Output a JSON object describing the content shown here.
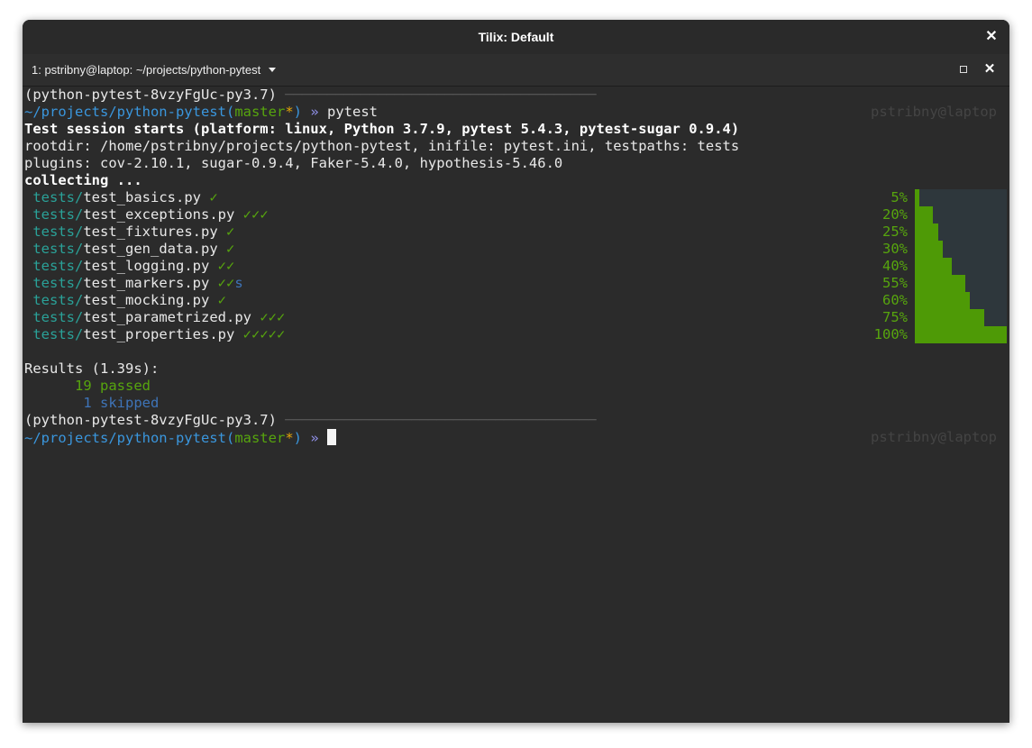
{
  "window": {
    "title": "Tilix: Default",
    "session_tab": "1: pstribny@laptop: ~/projects/python-pytest"
  },
  "terminal": {
    "venv": "(python-pytest-8vzyFgUc-py3.7)",
    "rule": " ─────────────────────────────────────",
    "cwd": "~/projects/python-pytest",
    "paren_open": "(",
    "branch": "master",
    "dirty": "*",
    "paren_close": ")",
    "arrow": " »",
    "command": " pytest",
    "right_prompt": "pstribny@laptop",
    "session_line": "Test session starts (platform: linux, Python 3.7.9, pytest 5.4.3, pytest-sugar 0.9.4)",
    "rootdir_line": "rootdir: /home/pstribny/projects/python-pytest, inifile: pytest.ini, testpaths: tests",
    "plugins_line": "plugins: cov-2.10.1, sugar-0.9.4, Faker-5.4.0, hypothesis-5.46.0",
    "collecting_line": "collecting ...",
    "test_dir": "tests/",
    "tests": [
      {
        "file": "test_basics.py",
        "marks": "✓",
        "skip": "",
        "percent": "5%",
        "progress": 0.05
      },
      {
        "file": "test_exceptions.py",
        "marks": "✓✓✓",
        "skip": "",
        "percent": "20%",
        "progress": 0.2
      },
      {
        "file": "test_fixtures.py",
        "marks": "✓",
        "skip": "",
        "percent": "25%",
        "progress": 0.25
      },
      {
        "file": "test_gen_data.py",
        "marks": "✓",
        "skip": "",
        "percent": "30%",
        "progress": 0.3
      },
      {
        "file": "test_logging.py",
        "marks": "✓✓",
        "skip": "",
        "percent": "40%",
        "progress": 0.4
      },
      {
        "file": "test_markers.py",
        "marks": "✓✓",
        "skip": "s",
        "percent": "55%",
        "progress": 0.55
      },
      {
        "file": "test_mocking.py",
        "marks": "✓",
        "skip": "",
        "percent": "60%",
        "progress": 0.6
      },
      {
        "file": "test_parametrized.py",
        "marks": "✓✓✓",
        "skip": "",
        "percent": "75%",
        "progress": 0.75
      },
      {
        "file": "test_properties.py",
        "marks": "✓✓✓✓✓",
        "skip": "",
        "percent": "100%",
        "progress": 1.0
      }
    ],
    "results_line": "Results (1.39s):",
    "passed_line": "      19 passed",
    "skipped_line": "       1 skipped"
  },
  "colors": {
    "terminal_bg": "#2b2b2b",
    "green": "#57a50e",
    "cyan": "#2aa198",
    "blue": "#3a96dd",
    "orange": "#e5a50a",
    "progress_fill": "#4e9a06",
    "progress_track": "#2e373c"
  }
}
